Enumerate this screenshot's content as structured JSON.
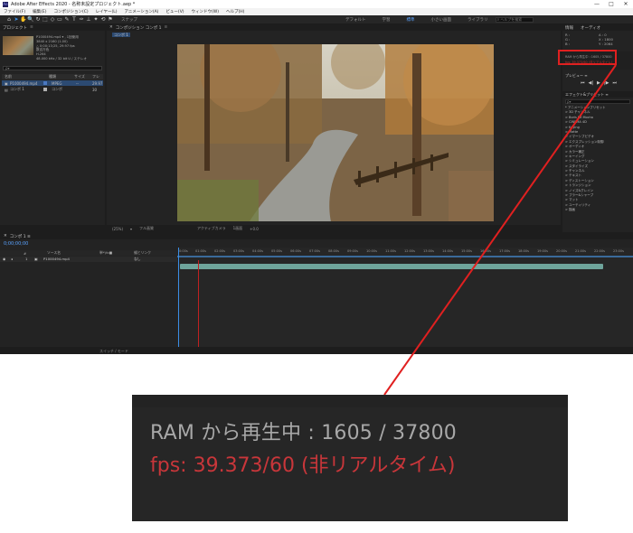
{
  "app": {
    "title": "Adobe After Effects 2020 - 名称未設定プロジェクト.aep *",
    "logo": "Ae",
    "window_controls": [
      "—",
      "□",
      "✕"
    ]
  },
  "menu": [
    "ファイル(F)",
    "編集(E)",
    "コンポジション(C)",
    "レイヤー(L)",
    "アニメーション(A)",
    "ビュー(V)",
    "ウィンドウ(W)",
    "ヘルプ(H)"
  ],
  "toolbar": {
    "tools": [
      "⌂",
      "➤",
      "✋",
      "🔍",
      "↻",
      "⬚",
      "◇",
      "▭",
      "✎",
      "T",
      "✑",
      "⊥",
      "✦",
      "⟲",
      "⚑"
    ],
    "snap_label": "スナップ",
    "workspaces": [
      "デフォルト",
      "学習",
      "標準",
      "小さい画面",
      "ライブラリ"
    ],
    "active_workspace": "標準",
    "search_placeholder": "ヘルプを検索"
  },
  "project": {
    "tab": "プロジェクト",
    "item_name": "P1000494.mp4 ▾ , 1回使用",
    "item_info": [
      "3840 x 2160 (1.00)",
      "△ 0;00;13;25, 29.97 fps",
      "数百万色",
      "H.264",
      "48.000 kHz / 32 bit U / ステレオ"
    ],
    "search_placeholder": "ρ▾",
    "columns": [
      "名前",
      "種類",
      "サイズ",
      "フレ"
    ],
    "rows": [
      {
        "name": "P1000494.mp4",
        "type": "MPEG",
        "size": "--",
        "fps": "29.97",
        "color": "#4a78c0",
        "selected": true
      },
      {
        "name": "コンポ 1",
        "type": "コンポ",
        "size": "",
        "fps": "30",
        "color": "#b0b0b0",
        "selected": false
      }
    ]
  },
  "composition": {
    "tab": "コンポジション コンポ 1",
    "subtab": "コンポ 1",
    "controls": [
      "(25%)",
      "▾",
      "フル画質",
      "アクティブカメラ",
      "1画面",
      "+0.0"
    ]
  },
  "info_panel": {
    "tabs": [
      "情報",
      "オーディオ"
    ],
    "stats": [
      "R :",
      "G :",
      "B :",
      "A : 0",
      "X : 1800",
      "Y : 2064"
    ]
  },
  "preview_status": {
    "ram_line": "RAM から再生中 : 1605 / 37800",
    "fps_line": "fps: 39.373/60 (非リアルタイム)"
  },
  "preview": {
    "label": "プレビュー ≡",
    "buttons": [
      "⏮",
      "◀|",
      "▶",
      "|▶",
      "⏭"
    ]
  },
  "effects": {
    "header": "エフェクト&プリセット ≡",
    "search_placeholder": "ρ▾",
    "items": [
      "* アニメーションプリセット",
      "> 3D チャンネル",
      "> Boris FX Mocha",
      "> CINEMA 4D",
      "> Keying",
      "> Matte",
      "> イマーシブビデオ",
      "> エクスプレッション制御",
      "> オーディオ",
      "> カラー補正",
      "> キーイング",
      "> シミュレーション",
      "> スタイライズ",
      "> チャンネル",
      "> テキスト",
      "> ディストーション",
      "> トランジション",
      "> ノイズ&グレイン",
      "> ブラー&シャープ",
      "> マット",
      "> ユーティリティ",
      "> 描画"
    ]
  },
  "timeline": {
    "tab": "コンポ 1 ≡",
    "current_time": "0;00;00;00",
    "columns": [
      "#",
      "ソース名",
      "単*\\fx■",
      "親とリンク"
    ],
    "layer": {
      "index": "1",
      "name": "P1000494.mp4",
      "parent": "なし"
    },
    "ruler": [
      "0:00s",
      "01:00s",
      "02:00s",
      "03:00s",
      "04:00s",
      "05:00s",
      "06:00s",
      "07:00s",
      "08:00s",
      "09:00s",
      "10:00s",
      "11:00s",
      "12:00s",
      "13:00s",
      "14:00s",
      "15:00s",
      "16:00s",
      "17:00s",
      "18:00s",
      "19:00s",
      "20:00s",
      "21:00s",
      "22:00s",
      "23:00s"
    ],
    "footer_mode": "スイッチ / モード"
  }
}
